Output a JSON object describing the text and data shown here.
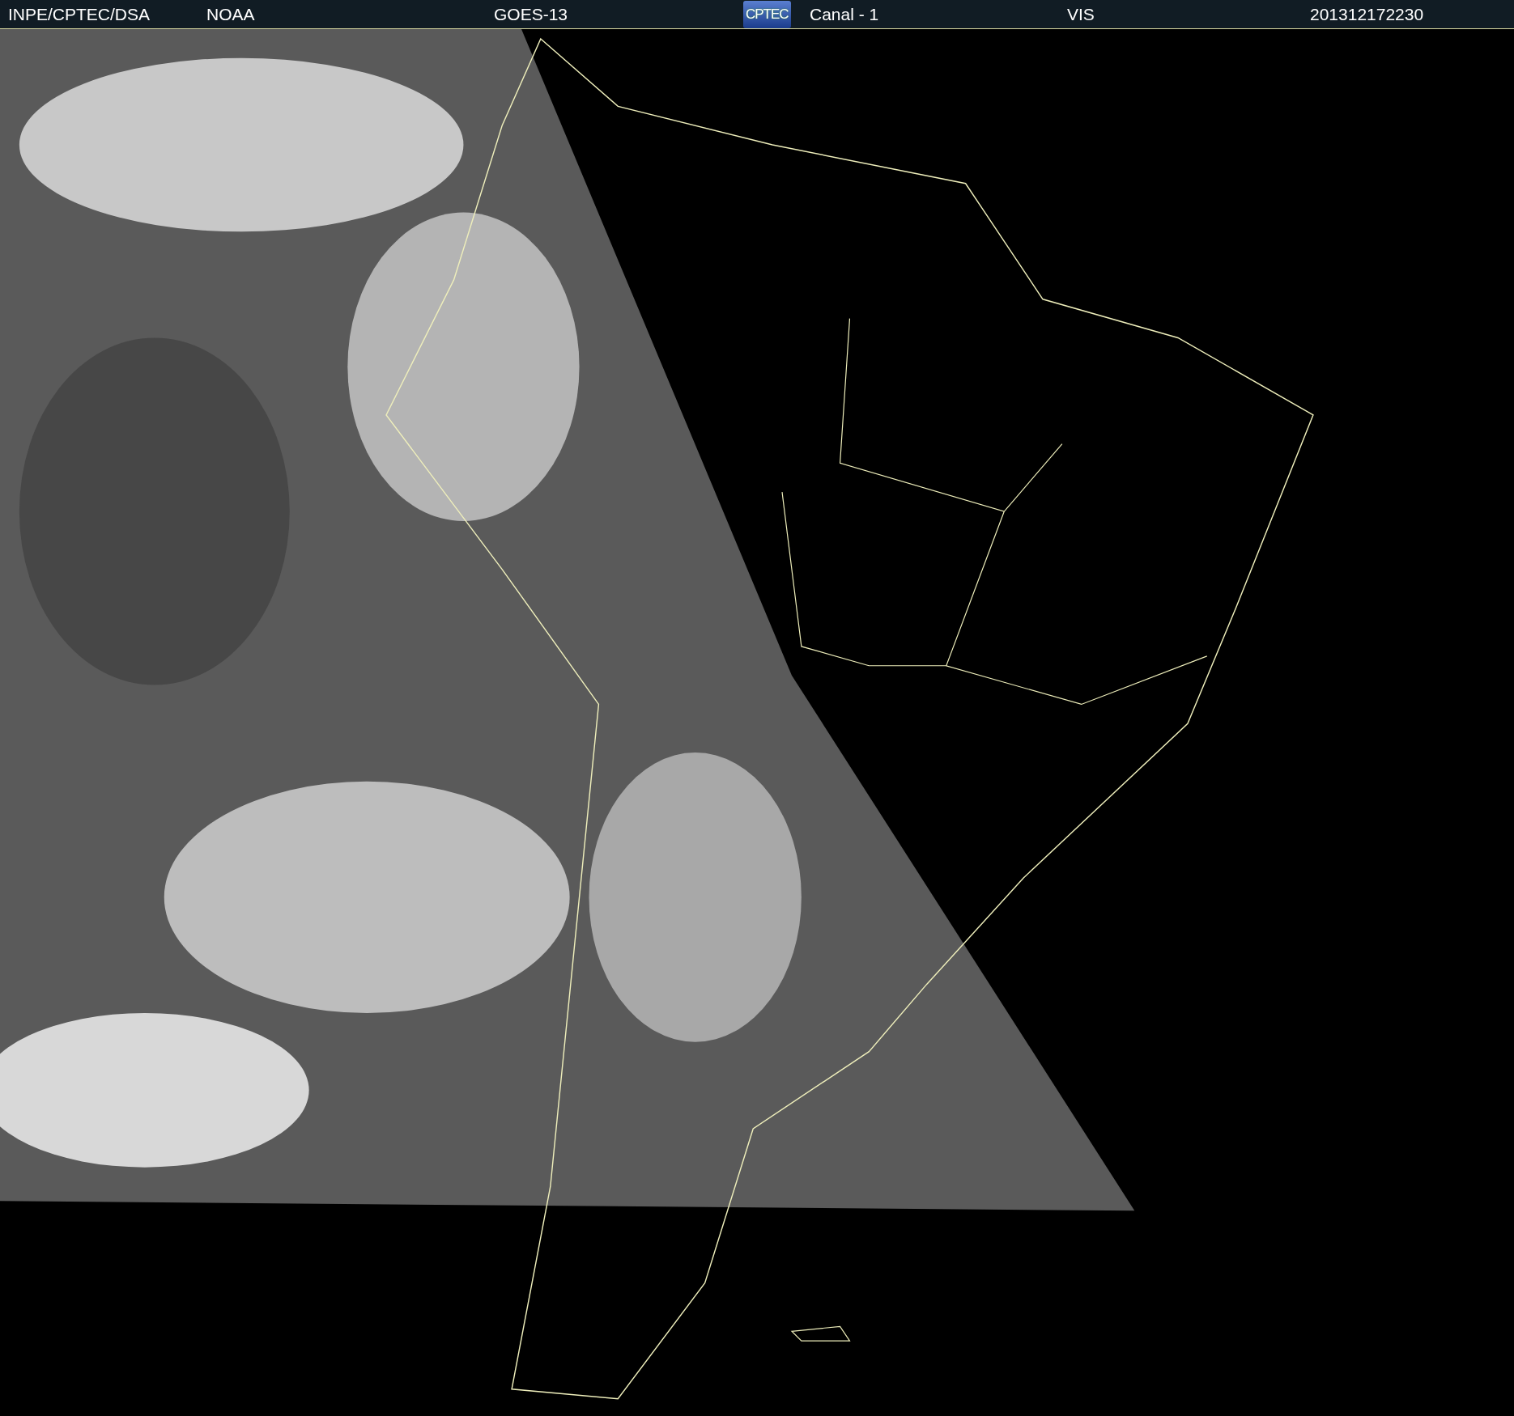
{
  "header": {
    "items": [
      {
        "kind": "text",
        "text": "INPE/CPTEC/DSA"
      },
      {
        "kind": "text",
        "text": "NOAA"
      },
      {
        "kind": "text",
        "text": "GOES-13"
      },
      {
        "kind": "logo",
        "text": "CPTEC"
      },
      {
        "kind": "text",
        "text": "Canal - 1"
      },
      {
        "kind": "text",
        "text": "VIS"
      },
      {
        "kind": "text",
        "text": "201312172230"
      }
    ]
  }
}
